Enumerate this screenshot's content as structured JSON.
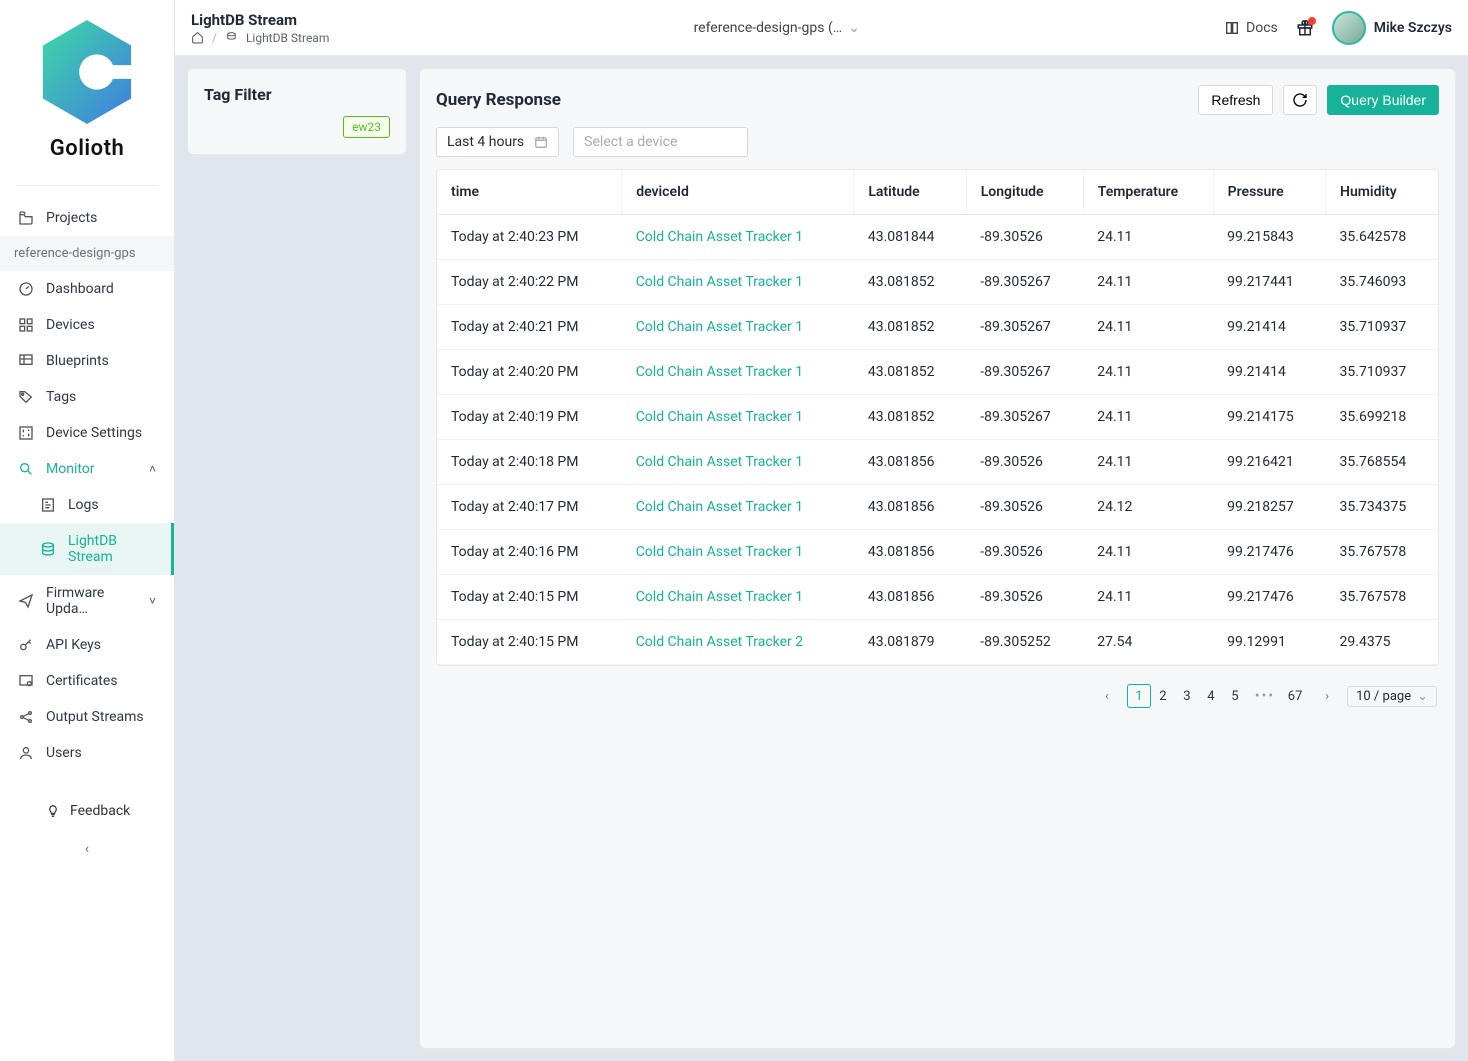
{
  "brand": "Golioth",
  "sidebar": {
    "projects_label": "Projects",
    "project_selected": "reference-design-gps",
    "items": [
      {
        "label": "Dashboard"
      },
      {
        "label": "Devices"
      },
      {
        "label": "Blueprints"
      },
      {
        "label": "Tags"
      },
      {
        "label": "Device Settings"
      },
      {
        "label": "Monitor"
      },
      {
        "label": "Firmware Upda…"
      },
      {
        "label": "API Keys"
      },
      {
        "label": "Certificates"
      },
      {
        "label": "Output Streams"
      },
      {
        "label": "Users"
      }
    ],
    "monitor_children": [
      {
        "label": "Logs"
      },
      {
        "label": "LightDB Stream"
      }
    ],
    "feedback_label": "Feedback"
  },
  "header": {
    "title": "LightDB Stream",
    "breadcrumb_current": "LightDB Stream",
    "project_dropdown": "reference-design-gps (…",
    "docs_label": "Docs",
    "user_name": "Mike Szczys"
  },
  "tag_filter": {
    "title": "Tag Filter",
    "tags": [
      "ew23"
    ]
  },
  "query": {
    "title": "Query Response",
    "refresh_label": "Refresh",
    "builder_label": "Query Builder",
    "time_range": "Last 4 hours",
    "device_placeholder": "Select a device",
    "columns": [
      "time",
      "deviceId",
      "Latitude",
      "Longitude",
      "Temperature",
      "Pressure",
      "Humidity"
    ],
    "rows": [
      {
        "time": "Today at 2:40:23 PM",
        "device": "Cold Chain Asset Tracker 1",
        "lat": "43.081844",
        "lon": "-89.30526",
        "temp": "24.11",
        "press": "99.215843",
        "hum": "35.642578"
      },
      {
        "time": "Today at 2:40:22 PM",
        "device": "Cold Chain Asset Tracker 1",
        "lat": "43.081852",
        "lon": "-89.305267",
        "temp": "24.11",
        "press": "99.217441",
        "hum": "35.746093"
      },
      {
        "time": "Today at 2:40:21 PM",
        "device": "Cold Chain Asset Tracker 1",
        "lat": "43.081852",
        "lon": "-89.305267",
        "temp": "24.11",
        "press": "99.21414",
        "hum": "35.710937"
      },
      {
        "time": "Today at 2:40:20 PM",
        "device": "Cold Chain Asset Tracker 1",
        "lat": "43.081852",
        "lon": "-89.305267",
        "temp": "24.11",
        "press": "99.21414",
        "hum": "35.710937"
      },
      {
        "time": "Today at 2:40:19 PM",
        "device": "Cold Chain Asset Tracker 1",
        "lat": "43.081852",
        "lon": "-89.305267",
        "temp": "24.11",
        "press": "99.214175",
        "hum": "35.699218"
      },
      {
        "time": "Today at 2:40:18 PM",
        "device": "Cold Chain Asset Tracker 1",
        "lat": "43.081856",
        "lon": "-89.30526",
        "temp": "24.11",
        "press": "99.216421",
        "hum": "35.768554"
      },
      {
        "time": "Today at 2:40:17 PM",
        "device": "Cold Chain Asset Tracker 1",
        "lat": "43.081856",
        "lon": "-89.30526",
        "temp": "24.12",
        "press": "99.218257",
        "hum": "35.734375"
      },
      {
        "time": "Today at 2:40:16 PM",
        "device": "Cold Chain Asset Tracker 1",
        "lat": "43.081856",
        "lon": "-89.30526",
        "temp": "24.11",
        "press": "99.217476",
        "hum": "35.767578"
      },
      {
        "time": "Today at 2:40:15 PM",
        "device": "Cold Chain Asset Tracker 1",
        "lat": "43.081856",
        "lon": "-89.30526",
        "temp": "24.11",
        "press": "99.217476",
        "hum": "35.767578"
      },
      {
        "time": "Today at 2:40:15 PM",
        "device": "Cold Chain Asset Tracker 2",
        "lat": "43.081879",
        "lon": "-89.305252",
        "temp": "27.54",
        "press": "99.12991",
        "hum": "29.4375"
      }
    ]
  },
  "pagination": {
    "pages": [
      "1",
      "2",
      "3",
      "4",
      "5"
    ],
    "last": "67",
    "current": "1",
    "page_size_label": "10 / page"
  }
}
